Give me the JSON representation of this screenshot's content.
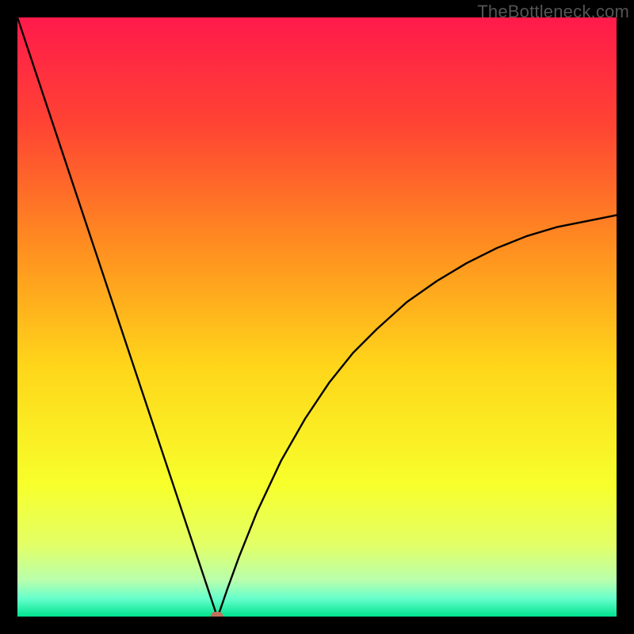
{
  "watermark": "TheBottleneck.com",
  "chart_data": {
    "type": "line",
    "title": "",
    "xlabel": "",
    "ylabel": "",
    "xlim": [
      0,
      100
    ],
    "ylim": [
      0,
      100
    ],
    "grid": false,
    "series": [
      {
        "name": "curve",
        "x": [
          0.0,
          2.0,
          5.0,
          8.0,
          11.0,
          14.0,
          17.0,
          20.0,
          23.0,
          26.0,
          28.0,
          30.0,
          31.5,
          32.5,
          33.0,
          33.3,
          33.8,
          35.0,
          37.0,
          40.0,
          44.0,
          48.0,
          52.0,
          56.0,
          60.0,
          65.0,
          70.0,
          75.0,
          80.0,
          85.0,
          90.0,
          95.0,
          100.0
        ],
        "values": [
          100.0,
          94.0,
          85.0,
          76.0,
          67.0,
          58.0,
          49.0,
          40.0,
          31.0,
          22.0,
          16.0,
          10.0,
          5.5,
          2.5,
          1.0,
          0.0,
          1.0,
          4.5,
          10.0,
          17.5,
          26.0,
          33.0,
          39.0,
          44.0,
          48.0,
          52.5,
          56.0,
          59.0,
          61.5,
          63.5,
          65.0,
          66.0,
          67.0
        ]
      }
    ],
    "marker": {
      "x": 33.3,
      "y": 0.0,
      "color": "#c1705c"
    },
    "gradient_stops": [
      {
        "pct": 0.0,
        "color": "#ff1a4b"
      },
      {
        "pct": 18.0,
        "color": "#ff4433"
      },
      {
        "pct": 38.0,
        "color": "#ff8d20"
      },
      {
        "pct": 58.0,
        "color": "#ffd51a"
      },
      {
        "pct": 78.0,
        "color": "#f7ff2b"
      },
      {
        "pct": 88.0,
        "color": "#e3ff66"
      },
      {
        "pct": 94.0,
        "color": "#b8ffad"
      },
      {
        "pct": 97.0,
        "color": "#66ffcc"
      },
      {
        "pct": 100.0,
        "color": "#00e38f"
      }
    ]
  }
}
